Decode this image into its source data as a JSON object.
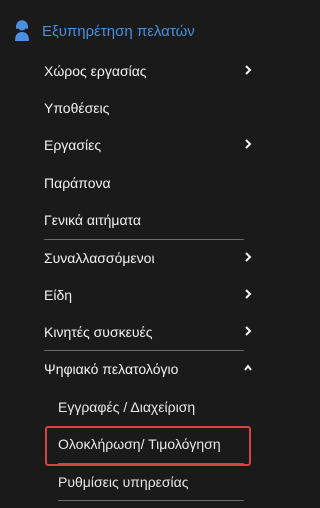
{
  "sidebar": {
    "section": {
      "icon": "customer-service-icon",
      "label": "Εξυπηρέτηση πελατών",
      "accent_color": "#4a8fe0"
    },
    "items": [
      {
        "label": "Χώρος εργασίας",
        "has_submenu": true,
        "expanded": false
      },
      {
        "label": "Υποθέσεις",
        "has_submenu": false
      },
      {
        "label": "Εργασίες",
        "has_submenu": true,
        "expanded": false
      },
      {
        "label": "Παράπονα",
        "has_submenu": false
      },
      {
        "label": "Γενικά αιτήματα",
        "has_submenu": false
      },
      {
        "label": "Συναλλασσόμενοι",
        "has_submenu": true,
        "expanded": false
      },
      {
        "label": "Είδη",
        "has_submenu": true,
        "expanded": false
      },
      {
        "label": "Κινητές συσκευές",
        "has_submenu": true,
        "expanded": false
      },
      {
        "label": "Ψηφιακό πελατολόγιο",
        "has_submenu": true,
        "expanded": true
      }
    ],
    "sub_items": [
      {
        "label": "Εγγραφές / Διαχείριση"
      },
      {
        "label": "Ολοκλήρωση/ Τιμολόγηση",
        "highlighted": true
      },
      {
        "label": "Ρυθμίσεις υπηρεσίας"
      }
    ],
    "highlight_color": "#d94040"
  }
}
